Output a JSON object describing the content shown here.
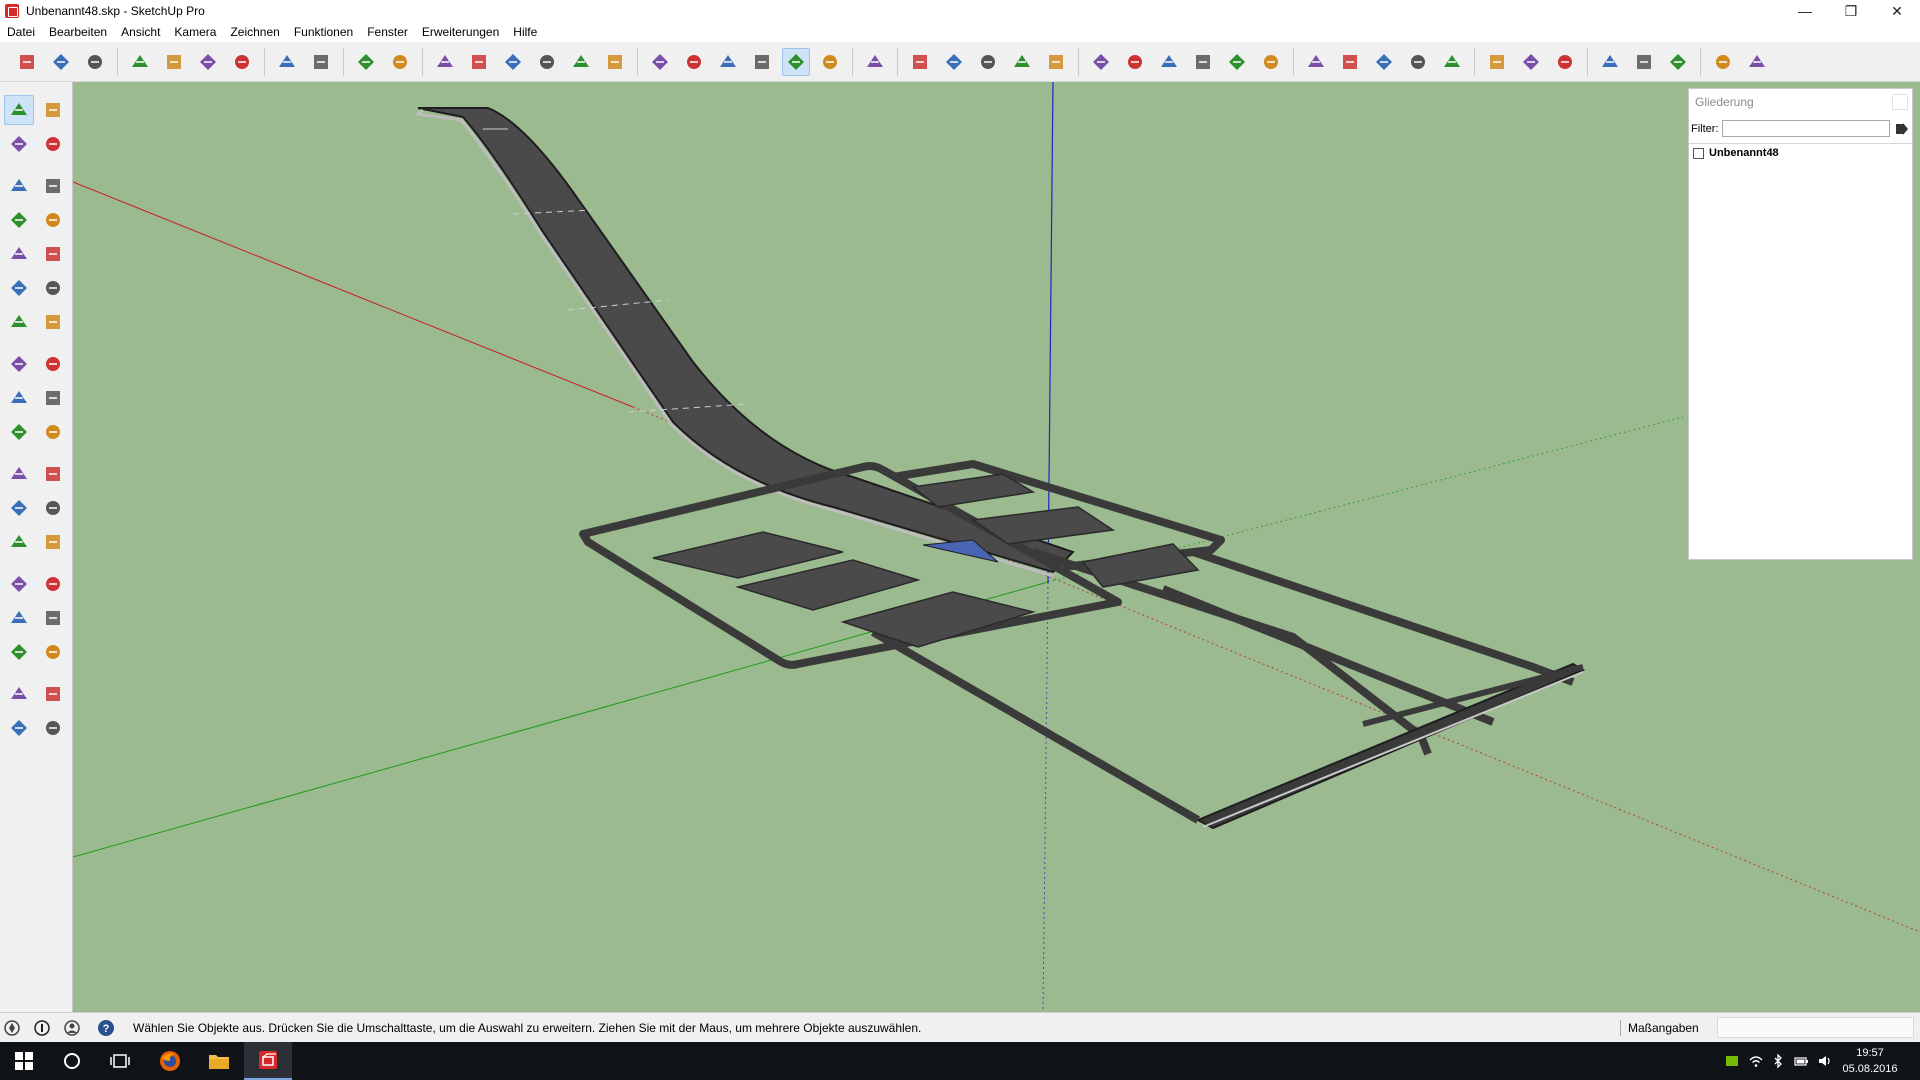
{
  "window": {
    "title": "Unbenannt48.skp - SketchUp Pro",
    "minimize_glyph": "—",
    "maximize_glyph": "❐",
    "close_glyph": "✕"
  },
  "menu": [
    "Datei",
    "Bearbeiten",
    "Ansicht",
    "Kamera",
    "Zeichnen",
    "Funktionen",
    "Fenster",
    "Erweiterungen",
    "Hilfe"
  ],
  "toolbar": {
    "icons": [
      "new-icon",
      "open-icon",
      "save-icon",
      "cut-icon",
      "copy-icon",
      "paste-icon",
      "erase-icon",
      "undo-icon",
      "redo-icon",
      "print-icon",
      "model-info-icon",
      "iso-view-icon",
      "top-view-icon",
      "front-view-icon",
      "right-view-icon",
      "back-view-icon",
      "left-view-icon",
      "xray-icon",
      "back-edges-icon",
      "wireframe-icon",
      "hidden-line-icon",
      "shaded-icon",
      "shaded-textures-icon",
      "monochrome-icon",
      "component-icon",
      "group-icon",
      "section-plane-icon",
      "section-fill-icon",
      "section-cut-icon",
      "outer-shell-icon",
      "intersect-icon",
      "union-icon",
      "subtract-icon",
      "trim-icon",
      "split-icon",
      "sandbox-from-contours-icon",
      "sandbox-smoove-icon",
      "sandbox-stamp-icon",
      "sandbox-drape-icon",
      "sandbox-add-detail-icon",
      "position-camera-icon",
      "parallel-projection-icon",
      "perspective-icon",
      "axes-icon",
      "scale-figure-icon",
      "align-icon",
      "materials-icon",
      "extension-manager-icon"
    ],
    "active_index": 21
  },
  "tools": {
    "rows": [
      [
        "select-icon",
        "component-icon"
      ],
      [
        "paint-bucket-icon",
        "eraser-icon"
      ],
      [
        "line-icon",
        "freehand-icon"
      ],
      [
        "rectangle-icon",
        "rotated-rectangle-icon"
      ],
      [
        "circle-icon",
        "polygon-icon"
      ],
      [
        "arc-icon",
        "two-point-arc-icon"
      ],
      [
        "three-point-arc-icon",
        "pie-icon"
      ],
      [
        "move-icon",
        "push-pull-icon"
      ],
      [
        "rotate-icon",
        "follow-me-icon"
      ],
      [
        "scale-icon",
        "offset-icon"
      ],
      [
        "tape-measure-icon",
        "dimension-icon"
      ],
      [
        "protractor-icon",
        "text-icon"
      ],
      [
        "axes-icon",
        "3d-text-icon"
      ],
      [
        "orbit-icon",
        "pan-icon"
      ],
      [
        "zoom-icon",
        "zoom-window-icon"
      ],
      [
        "zoom-extents-icon",
        "previous-view-icon"
      ],
      [
        "position-camera-icon",
        "look-around-icon"
      ],
      [
        "walk-icon",
        "section-plane-icon"
      ]
    ]
  },
  "outliner": {
    "title": "Gliederung",
    "filter_label": "Filter:",
    "filter_value": "",
    "items": [
      {
        "label": "Unbenannt48"
      }
    ]
  },
  "status": {
    "message": "Wählen Sie Objekte aus. Drücken Sie die Umschalttaste, um die Auswahl zu erweitern. Ziehen Sie mit der Maus, um mehrere Objekte auszuwählen.",
    "measurements_label": "Maßangaben",
    "measurements_value": ""
  },
  "taskbar": {
    "time": "19:57",
    "date": "05.08.2016"
  },
  "colors": {
    "ground": "#9bba8f",
    "road": "#4a4a4a",
    "red_axis": "#c62020",
    "green_axis": "#1f9a1f",
    "blue_axis": "#2323c8"
  }
}
